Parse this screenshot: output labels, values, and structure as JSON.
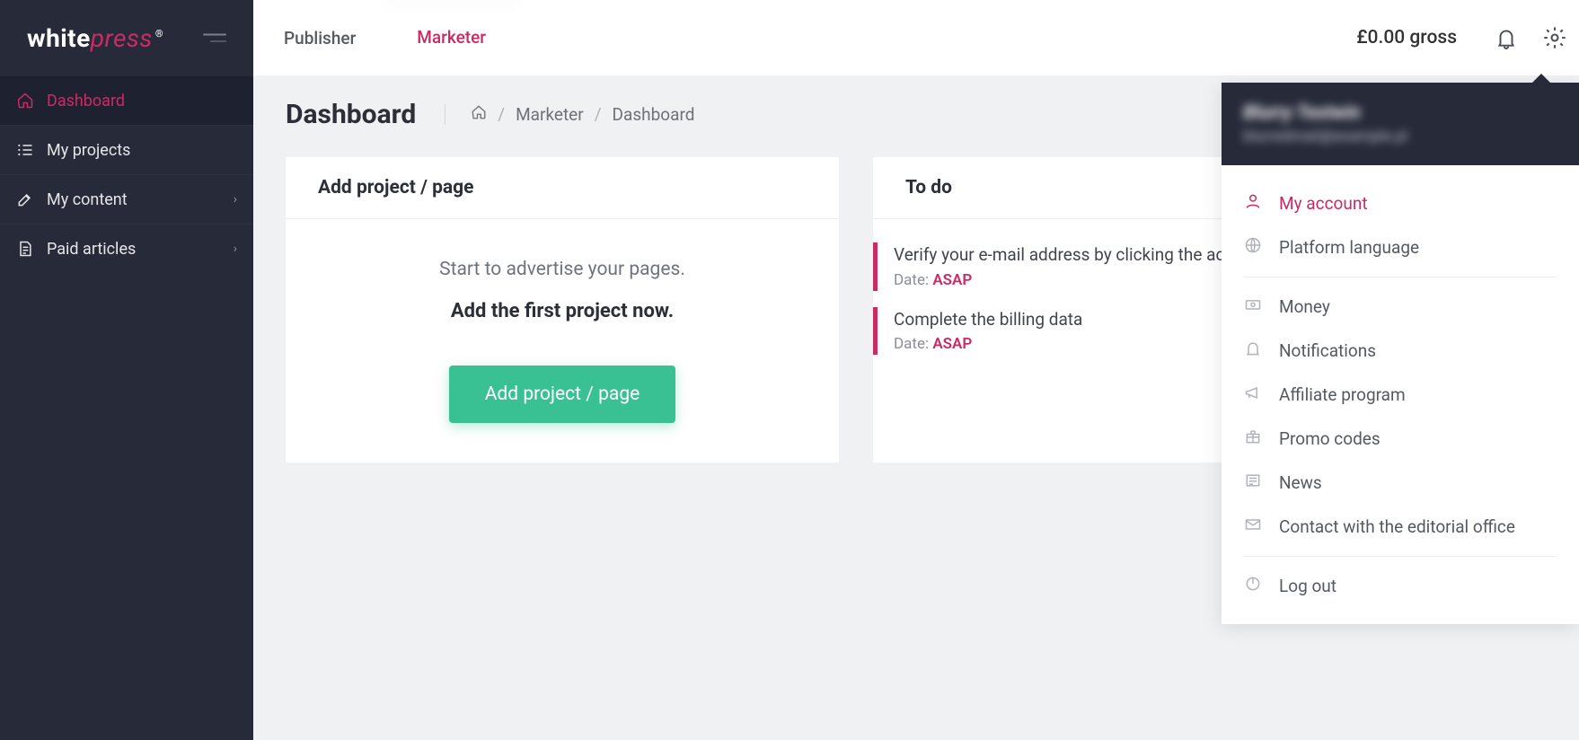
{
  "logo": {
    "part1": "white",
    "part2": "press",
    "sup": "®"
  },
  "sidebar": {
    "items": [
      {
        "label": "Dashboard"
      },
      {
        "label": "My projects"
      },
      {
        "label": "My content"
      },
      {
        "label": "Paid articles"
      }
    ]
  },
  "topbar": {
    "tabs": [
      {
        "label": "Publisher"
      },
      {
        "label": "Marketer"
      }
    ],
    "balance": "£0.00 gross"
  },
  "page": {
    "title": "Dashboard",
    "breadcrumb": {
      "root": "Marketer",
      "current": "Dashboard"
    }
  },
  "addProject": {
    "heading": "Add project / page",
    "line1": "Start to advertise your pages.",
    "line2": "Add the first project now.",
    "button": "Add project / page"
  },
  "todo": {
    "heading": "To do",
    "items": [
      {
        "text": "Verify your e-mail address by clicking the activation link in the message.",
        "dateLabel": "Date:",
        "date": "ASAP"
      },
      {
        "text": "Complete the billing data",
        "dateLabel": "Date:",
        "date": "ASAP"
      }
    ]
  },
  "settingsMenu": {
    "name": "Blurry Testwin",
    "email": "blurredmail@example.pl",
    "items": [
      {
        "label": "My account"
      },
      {
        "label": "Platform language"
      },
      {
        "label": "Money"
      },
      {
        "label": "Notifications"
      },
      {
        "label": "Affiliate program"
      },
      {
        "label": "Promo codes"
      },
      {
        "label": "News"
      },
      {
        "label": "Contact with the editorial office"
      },
      {
        "label": "Log out"
      }
    ]
  }
}
